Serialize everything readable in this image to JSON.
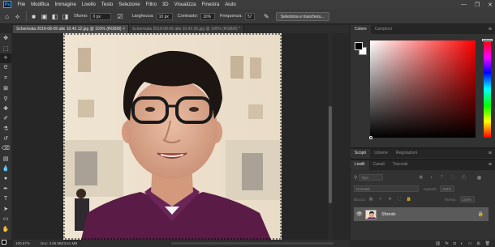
{
  "app": {
    "logo": "Ps"
  },
  "menu": [
    "File",
    "Modifica",
    "Immagine",
    "Livello",
    "Testo",
    "Selezione",
    "Filtro",
    "3D",
    "Visualizza",
    "Finestra",
    "Aiuto"
  ],
  "window_controls": {
    "minimize": "—",
    "restore": "❐",
    "close": "✕"
  },
  "options_bar": {
    "tool_icon": "quick-selection-icon",
    "sfumo_label": "Sfumo:",
    "sfumo_value": "0 px",
    "larghezza_label": "Larghezza:",
    "larghezza_value": "10 px",
    "contrasto_label": "Contrasto:",
    "contrasto_value": "10%",
    "frequenza_label": "Frequenza:",
    "frequenza_value": "57",
    "select_mask_button": "Seleziona e maschera..."
  },
  "document_tabs": [
    {
      "label": "Schermata 2019-08-05 alle 10.42.12.jpg @ 101% (RGB/8) ×",
      "active": true
    },
    {
      "label": "Schermata 2019-08-05 alle 10.42.35.jpg @ 100% (RGB/8) *",
      "active": false
    }
  ],
  "status_bar": {
    "zoom": "100.67%",
    "doc": "Doc: 3.65 MB/3.61 MB"
  },
  "color_panel": {
    "tabs": [
      "Colore",
      "Campioni"
    ],
    "active_tab": "Colore",
    "foreground": "#000000",
    "background": "#ffffff",
    "hue": "#ff0000"
  },
  "learn_panel": {
    "tabs": [
      "Scopri",
      "Librerie",
      "Regolazioni"
    ]
  },
  "layers_panel": {
    "tabs": [
      "Livelli",
      "Canali",
      "Tracciati"
    ],
    "active_tab": "Livelli",
    "filter_label": "Tipo",
    "blend_mode": "Normale",
    "opacity_label": "Opacità:",
    "opacity_value": "100%",
    "lock_label": "Blocca:",
    "fill_label": "Riemp.:",
    "fill_value": "100%",
    "layers": [
      {
        "name": "Sfondo",
        "visible": true,
        "locked": true
      }
    ]
  }
}
